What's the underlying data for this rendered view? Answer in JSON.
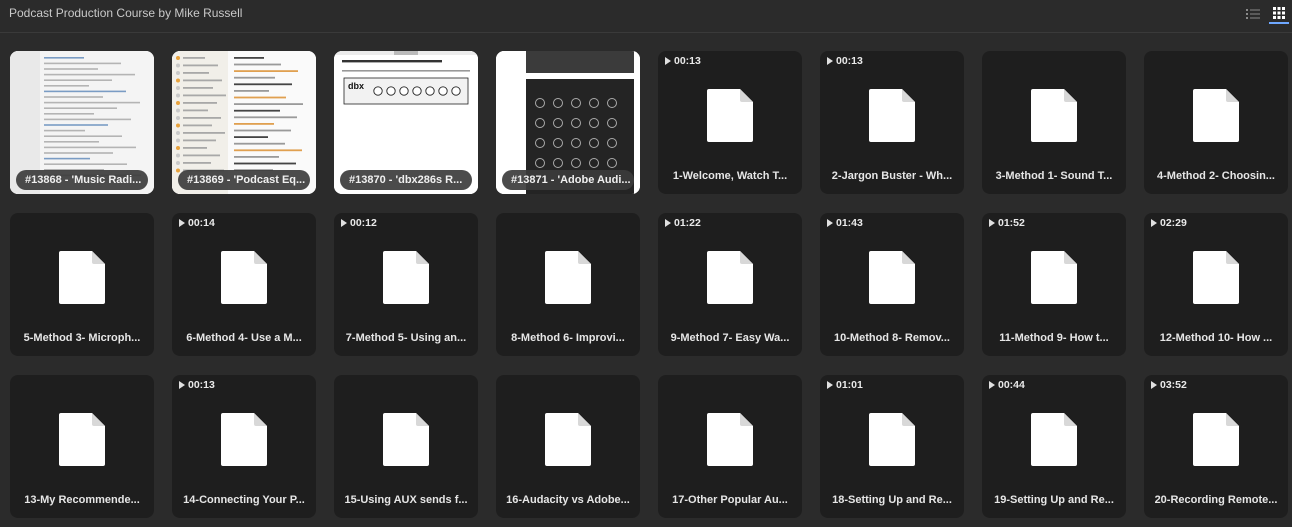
{
  "header": {
    "title": "Podcast Production Course by Mike Russell",
    "list_view_icon": "list-view-icon",
    "grid_view_icon": "grid-view-icon",
    "accent": "#6fa8ff"
  },
  "tiles": [
    {
      "kind": "shot",
      "style": "list",
      "label": "#13868 - 'Music Radi..."
    },
    {
      "kind": "shot",
      "style": "checklist",
      "label": "#13869 - 'Podcast Eq..."
    },
    {
      "kind": "shot",
      "style": "gear",
      "label": "#13870 - 'dbx286s R..."
    },
    {
      "kind": "shot",
      "style": "dark",
      "label": "#13871 - 'Adobe Audi..."
    },
    {
      "kind": "file",
      "duration": "00:13",
      "label": "1-Welcome, Watch T..."
    },
    {
      "kind": "file",
      "duration": "00:13",
      "label": "2-Jargon Buster - Wh..."
    },
    {
      "kind": "file",
      "duration": "",
      "label": "3-Method 1- Sound T..."
    },
    {
      "kind": "file",
      "duration": "",
      "label": "4-Method 2- Choosin..."
    },
    {
      "kind": "file",
      "duration": "",
      "label": "5-Method 3- Microph..."
    },
    {
      "kind": "file",
      "duration": "00:14",
      "label": "6-Method 4- Use a M..."
    },
    {
      "kind": "file",
      "duration": "00:12",
      "label": "7-Method 5- Using an..."
    },
    {
      "kind": "file",
      "duration": "",
      "label": "8-Method 6- Improvi..."
    },
    {
      "kind": "file",
      "duration": "01:22",
      "label": "9-Method 7- Easy Wa..."
    },
    {
      "kind": "file",
      "duration": "01:43",
      "label": "10-Method 8- Remov..."
    },
    {
      "kind": "file",
      "duration": "01:52",
      "label": "11-Method 9- How t..."
    },
    {
      "kind": "file",
      "duration": "02:29",
      "label": "12-Method 10- How ..."
    },
    {
      "kind": "file",
      "duration": "",
      "label": "13-My Recommende..."
    },
    {
      "kind": "file",
      "duration": "00:13",
      "label": "14-Connecting Your P..."
    },
    {
      "kind": "file",
      "duration": "",
      "label": "15-Using AUX sends f..."
    },
    {
      "kind": "file",
      "duration": "",
      "label": "16-Audacity vs Adobe..."
    },
    {
      "kind": "file",
      "duration": "",
      "label": "17-Other Popular Au..."
    },
    {
      "kind": "file",
      "duration": "01:01",
      "label": "18-Setting Up and Re..."
    },
    {
      "kind": "file",
      "duration": "00:44",
      "label": "19-Setting Up and Re..."
    },
    {
      "kind": "file",
      "duration": "03:52",
      "label": "20-Recording Remote..."
    }
  ]
}
